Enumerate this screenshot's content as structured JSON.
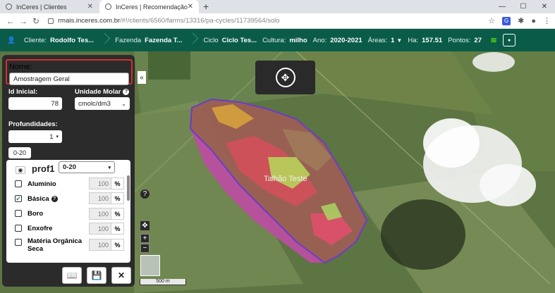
{
  "browser": {
    "tabs": [
      {
        "label": "InCeres | Clientes"
      },
      {
        "label": "InCeres | Recomendação"
      }
    ],
    "url_host": "rmais.inceres.com.br",
    "url_path": "/#!/clients/6560/farms/13316/pa-cycles/11739564/solo"
  },
  "appbar": {
    "cliente_label": "Cliente:",
    "cliente_value": "Rodolfo Tes...",
    "fazenda_label": "Fazenda",
    "fazenda_value": "Fazenda T...",
    "ciclo_label": "Ciclo",
    "ciclo_value": "Ciclo Tes...",
    "cultura_label": "Cultura:",
    "cultura_value": "milho",
    "ano_label": "Ano:",
    "ano_value": "2020-2021",
    "areas_label": "Áreas:",
    "areas_value": "1",
    "ha_label": "Ha:",
    "ha_value": "157.51",
    "pontos_label": "Pontos:",
    "pontos_value": "27"
  },
  "panel": {
    "nome_label": "Nome:",
    "nome_value": "Amostragem Geral",
    "id_inicial_label": "Id Inicial:",
    "id_inicial_value": "78",
    "unidade_molar_label": "Unidade Molar",
    "unidade_molar_value": "cmolc/dm3",
    "profundidades_label": "Profundidades:",
    "profundidades_value": "1",
    "depth_tab": "0-20",
    "prof_title": "prof1",
    "prof_select": "0-20",
    "nutrients": [
      {
        "label": "Alumínio",
        "checked": false,
        "value": "100",
        "unit": "%"
      },
      {
        "label": "Básica",
        "checked": true,
        "value": "100",
        "unit": "%"
      },
      {
        "label": "Boro",
        "checked": false,
        "value": "100",
        "unit": "%"
      },
      {
        "label": "Enxofre",
        "checked": false,
        "value": "100",
        "unit": "%"
      },
      {
        "label": "Matéria Orgânica Seca",
        "checked": false,
        "value": "100",
        "unit": "%"
      }
    ]
  },
  "map": {
    "area_label": "Talhão Teste",
    "scale_label": "500 m",
    "help_label": "?",
    "zoom_in": "+",
    "zoom_out": "−"
  }
}
